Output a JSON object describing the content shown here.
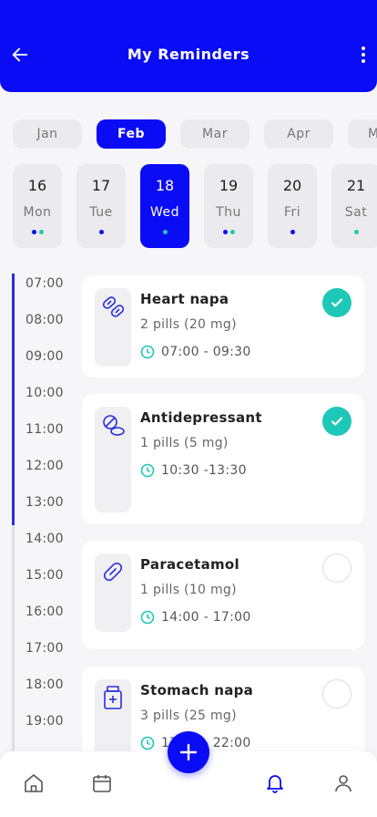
{
  "header": {
    "title": "My Reminders",
    "back_icon": "arrow-left-icon",
    "menu_icon": "more-vertical-icon"
  },
  "colors": {
    "primary": "#0a0cf5",
    "accent": "#1ec8b8",
    "muted_bg": "#ebebef"
  },
  "months": [
    {
      "label": "Jan",
      "active": false
    },
    {
      "label": "Feb",
      "active": true
    },
    {
      "label": "Mar",
      "active": false
    },
    {
      "label": "Apr",
      "active": false
    },
    {
      "label": "May",
      "active": false
    }
  ],
  "days": [
    {
      "num": "16",
      "name": "Mon",
      "active": false,
      "dots": [
        "blue",
        "teal"
      ]
    },
    {
      "num": "17",
      "name": "Tue",
      "active": false,
      "dots": [
        "blue"
      ]
    },
    {
      "num": "18",
      "name": "Wed",
      "active": true,
      "dots": [
        "teal"
      ]
    },
    {
      "num": "19",
      "name": "Thu",
      "active": false,
      "dots": [
        "blue",
        "teal"
      ]
    },
    {
      "num": "20",
      "name": "Fri",
      "active": false,
      "dots": [
        "blue"
      ]
    },
    {
      "num": "21",
      "name": "Sat",
      "active": false,
      "dots": [
        "teal"
      ]
    }
  ],
  "times": [
    "07:00",
    "08:00",
    "09:00",
    "10:00",
    "11:00",
    "12:00",
    "13:00",
    "14:00",
    "15:00",
    "16:00",
    "17:00",
    "18:00",
    "19:00"
  ],
  "reminders": [
    {
      "name": "Heart napa",
      "dose": "2 pills (20 mg)",
      "time_range": "07:00 - 09:30",
      "done": true,
      "icon": "capsules-icon"
    },
    {
      "name": "Antidepressant",
      "dose": "1 pills (5 mg)",
      "time_range": "10:30 -13:30",
      "done": true,
      "icon": "tablets-icon"
    },
    {
      "name": "Paracetamol",
      "dose": "1 pills (10 mg)",
      "time_range": "14:00 - 17:00",
      "done": false,
      "icon": "pill-icon"
    },
    {
      "name": "Stomach napa",
      "dose": "3 pills (25 mg)",
      "time_range": "17:00 - 22:00",
      "done": false,
      "icon": "medicine-bottle-icon"
    }
  ],
  "nav": [
    {
      "name": "home",
      "icon": "home-icon",
      "active": false
    },
    {
      "name": "calendar",
      "icon": "calendar-icon",
      "active": false
    },
    {
      "name": "notifications",
      "icon": "bell-icon",
      "active": true
    },
    {
      "name": "profile",
      "icon": "user-icon",
      "active": false
    }
  ],
  "fab_icon": "plus-icon"
}
